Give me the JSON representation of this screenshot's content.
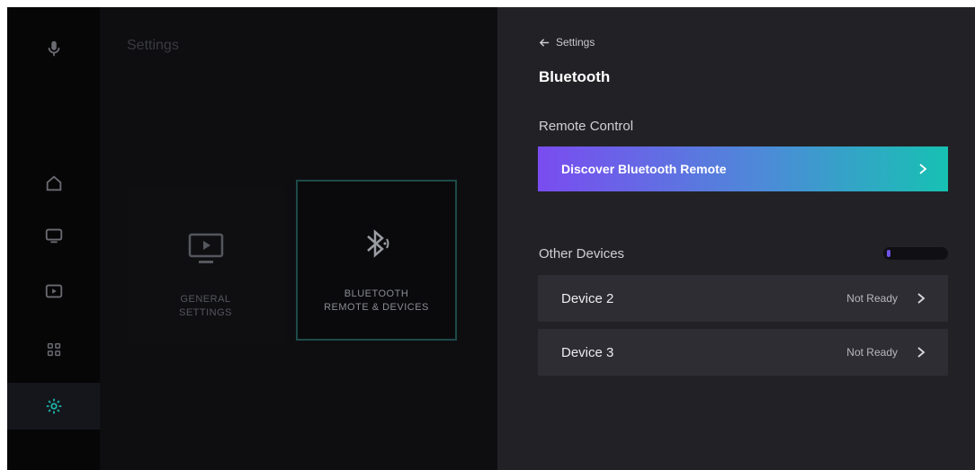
{
  "rail": {
    "icons": [
      "microphone-icon",
      "home-icon",
      "tv-icon",
      "media-icon",
      "apps-icon",
      "settings-gear-icon"
    ],
    "active": "settings-gear-icon",
    "accent": "#1fb5a8"
  },
  "background": {
    "title": "Settings",
    "tiles": [
      {
        "label": "GENERAL\nSETTINGS",
        "icon": "monitor-icon"
      },
      {
        "label": "BLUETOOTH\nREMOTE & DEVICES",
        "icon": "bluetooth-icon"
      }
    ]
  },
  "panel": {
    "back_label": "Settings",
    "title": "Bluetooth",
    "remote_section": "Remote Control",
    "discover_label": "Discover Bluetooth Remote",
    "other_section": "Other Devices",
    "devices": [
      {
        "name": "Device 2",
        "status": "Not Ready"
      },
      {
        "name": "Device 3",
        "status": "Not Ready"
      }
    ],
    "gradient": [
      "#7a4cf0",
      "#4d8ad8",
      "#17c1b3"
    ]
  }
}
